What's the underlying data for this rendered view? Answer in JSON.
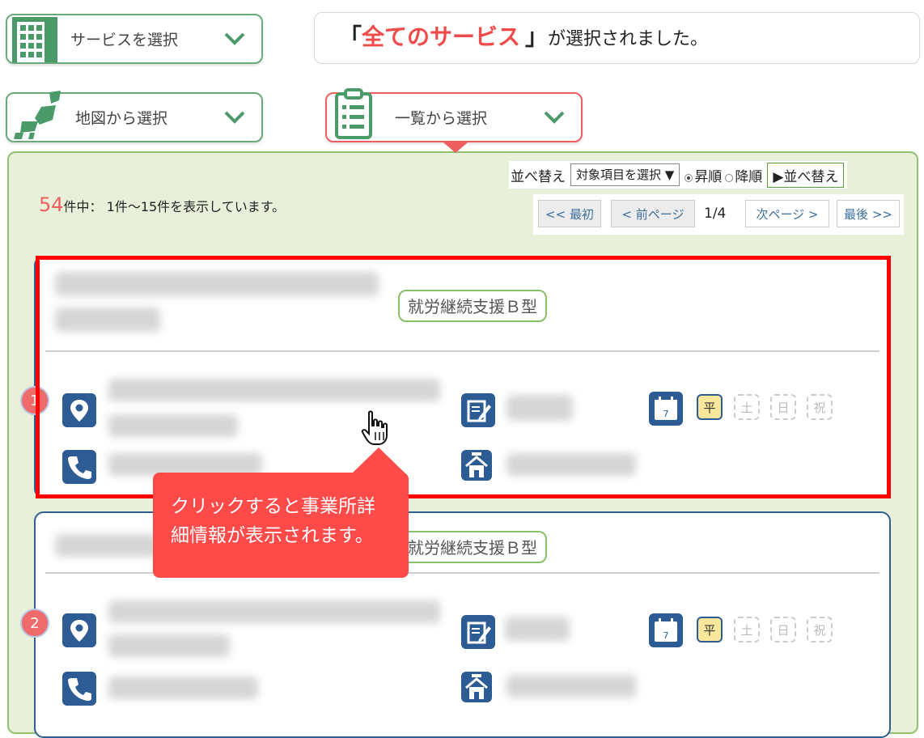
{
  "selectors": {
    "service": {
      "label": "サービスを選択"
    },
    "map": {
      "label": "地図から選択"
    },
    "list": {
      "label": "一覧から選択"
    }
  },
  "notice": {
    "open_bracket": "「",
    "highlight": "全てのサービス",
    "close_bracket": "」",
    "rest": "が選択されました。"
  },
  "sort": {
    "label": "並べ替え",
    "select_value": "対象項目を選択 ▼",
    "asc": "昇順",
    "desc": "降順",
    "button": "▶並べ替え"
  },
  "results": {
    "total": "54",
    "summary": "件中： 1件～15件を表示しています。"
  },
  "pager": {
    "first": "<< 最初",
    "prev": "< 前ページ",
    "page": "1/4",
    "next": "次ページ >",
    "last": "最後 >>"
  },
  "cards": [
    {
      "number": "1",
      "service_type": "就労継続支援Ｂ型",
      "days": [
        "平",
        "土",
        "日",
        "祝"
      ]
    },
    {
      "number": "2",
      "service_type": "就労継続支援Ｂ型",
      "days": [
        "平",
        "土",
        "日",
        "祝"
      ]
    }
  ],
  "tooltip": {
    "line1": "クリックすると事業所詳",
    "line2": "細情報が表示されます。"
  },
  "colors": {
    "accent_red": "#ef4b4b",
    "panel_green": "#e8f0da",
    "card_blue": "#2d5f8f",
    "icon_green": "#4a9a6a"
  }
}
